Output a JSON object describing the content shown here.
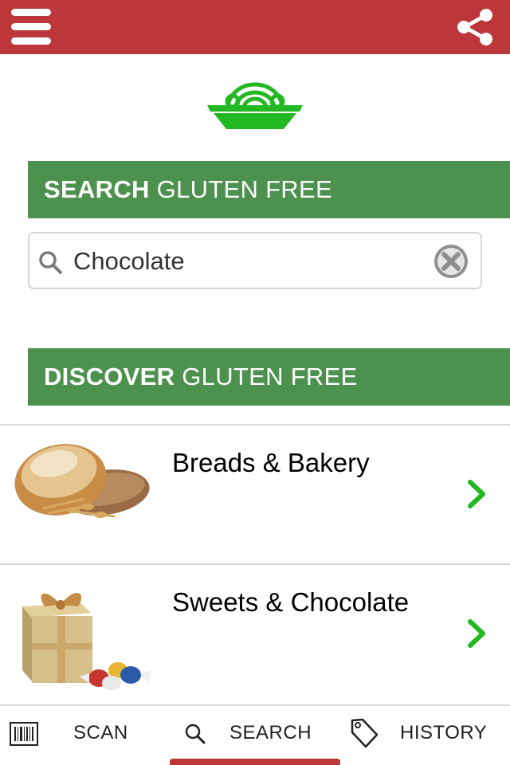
{
  "colors": {
    "brand_red": "#bd363b",
    "header_green": "#4c914d",
    "icon_green": "#22b822",
    "divider_gray": "#d9d9d9"
  },
  "topbar": {
    "menu_icon": "hamburger-menu-icon",
    "share_icon": "share-icon"
  },
  "logo": {
    "icon": "pasta-bowl-logo"
  },
  "search_section": {
    "title_bold": "SEARCH",
    "title_rest": " GLUTEN FREE",
    "search_icon": "search-icon",
    "query": "Chocolate",
    "clear_icon": "clear-circle-icon"
  },
  "discover_section": {
    "title_bold": "DISCOVER",
    "title_rest": " GLUTEN FREE",
    "categories": [
      {
        "label": "Breads & Bakery",
        "image": "bread-loaf-image",
        "arrow_icon": "chevron-right-icon"
      },
      {
        "label": "Sweets & Chocolate",
        "image": "chocolate-gift-box-image",
        "arrow_icon": "chevron-right-icon"
      }
    ]
  },
  "tabbar": {
    "tabs": [
      {
        "label": "SCAN",
        "icon": "barcode-icon"
      },
      {
        "label": "SEARCH",
        "icon": "search-icon",
        "active": true
      },
      {
        "label": "HISTORY",
        "icon": "tag-icon"
      }
    ]
  }
}
